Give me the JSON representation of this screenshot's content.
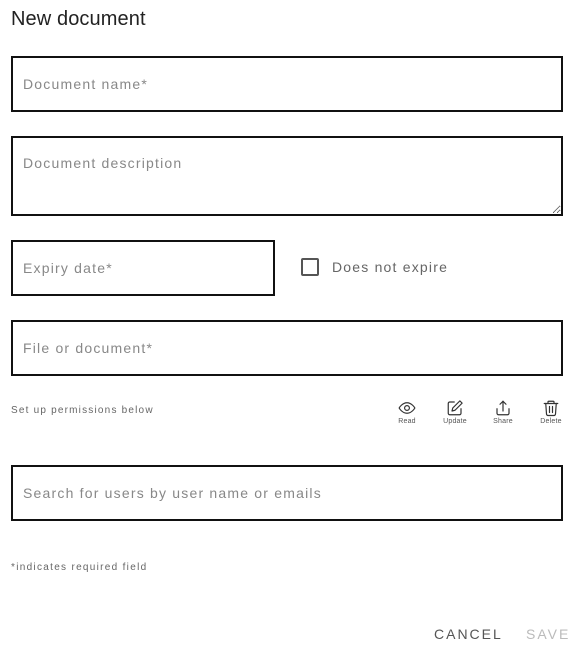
{
  "dialog": {
    "title": "New document"
  },
  "fields": {
    "name_placeholder": "Document name*",
    "description_placeholder": "Document description",
    "expiry_placeholder": "Expiry date*",
    "file_placeholder": "File or document*",
    "search_placeholder": "Search for users by user name or emails"
  },
  "expiry": {
    "does_not_expire_label": "Does not expire",
    "does_not_expire_checked": false
  },
  "permissions": {
    "hint": "Set up permissions below",
    "items": [
      {
        "label": "Read",
        "icon": "eye-icon"
      },
      {
        "label": "Update",
        "icon": "edit-icon"
      },
      {
        "label": "Share",
        "icon": "share-icon"
      },
      {
        "label": "Delete",
        "icon": "trash-icon"
      }
    ]
  },
  "footer": {
    "required_note": "*indicates required field",
    "cancel_label": "CANCEL",
    "save_label": "SAVE",
    "save_disabled": true
  }
}
